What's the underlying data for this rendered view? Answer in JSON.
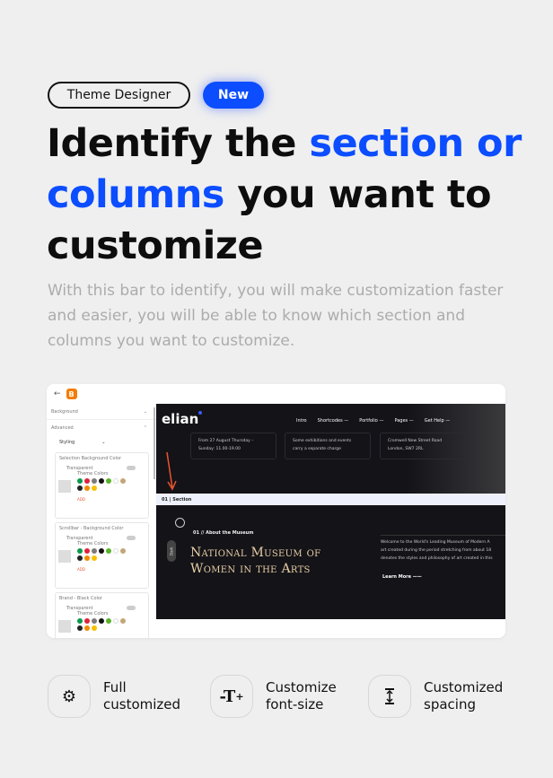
{
  "badges": {
    "theme_designer": "Theme Designer",
    "new": "New"
  },
  "headline": {
    "part1": "Identify the ",
    "highlight": "section or columns",
    "part2": " you want to customize"
  },
  "subtitle": "With this bar to identify, you will make customization faster and easier, you will be able to know which section and columns you want to customize.",
  "colors": {
    "accent": "#0b4dff",
    "background": "#efefef",
    "site_dark": "#141318",
    "arrow": "#e8552f"
  },
  "screenshot": {
    "sidebar": {
      "rows": [
        "Background",
        "Advanced"
      ],
      "styling": "Styling",
      "panels": [
        {
          "title": "Selection Background Color",
          "transparent": "Transparent",
          "theme_colors": "Theme Colors",
          "add": "ADD"
        },
        {
          "title": "Scrollbar - Background Color",
          "transparent": "Transparent",
          "theme_colors": "Theme Colors",
          "add": "ADD"
        },
        {
          "title": "Brand - Black Color",
          "transparent": "Transparent",
          "theme_colors": "Theme Colors",
          "add": ""
        }
      ],
      "theme_colors": [
        "#0a9a4a",
        "#e0223c",
        "#7a7a7a",
        "#111111",
        "#59b32a",
        "#ffffff",
        "#c4a57a",
        "#222222",
        "#f08a00",
        "#f7c000"
      ]
    },
    "site": {
      "logo": "elian",
      "nav": [
        "Intro",
        "Shortcodes —",
        "Portfolio —",
        "Pages —",
        "Get Help —"
      ],
      "info": [
        [
          "From 27 August Thursday –",
          "Sunday: 11.00-19.00"
        ],
        [
          "Some exhibitions and events",
          "carry a separate charge"
        ],
        [
          "Cromwell New Street Road",
          "London, SW7 2RL"
        ]
      ],
      "section_label": "01 | Section",
      "dark_toggle": "Dark",
      "eyebrow": "01 // About the Museum",
      "title_line1": "National Museum of",
      "title_line2": "Women in the Arts",
      "paragraph": [
        "Welcome to the World's Leading Museum of Modern A",
        "art created during the period stretching from about 18",
        "denotes the styles and philosophy of art created in this"
      ],
      "learn_more": "Learn More ——"
    }
  },
  "features": [
    {
      "icon": "gear-icon",
      "line1": "Full",
      "line2": "customized"
    },
    {
      "icon": "font-size-icon",
      "line1": "Customize",
      "line2": "font-size"
    },
    {
      "icon": "spacing-icon",
      "line1": "Customized",
      "line2": "spacing"
    }
  ]
}
